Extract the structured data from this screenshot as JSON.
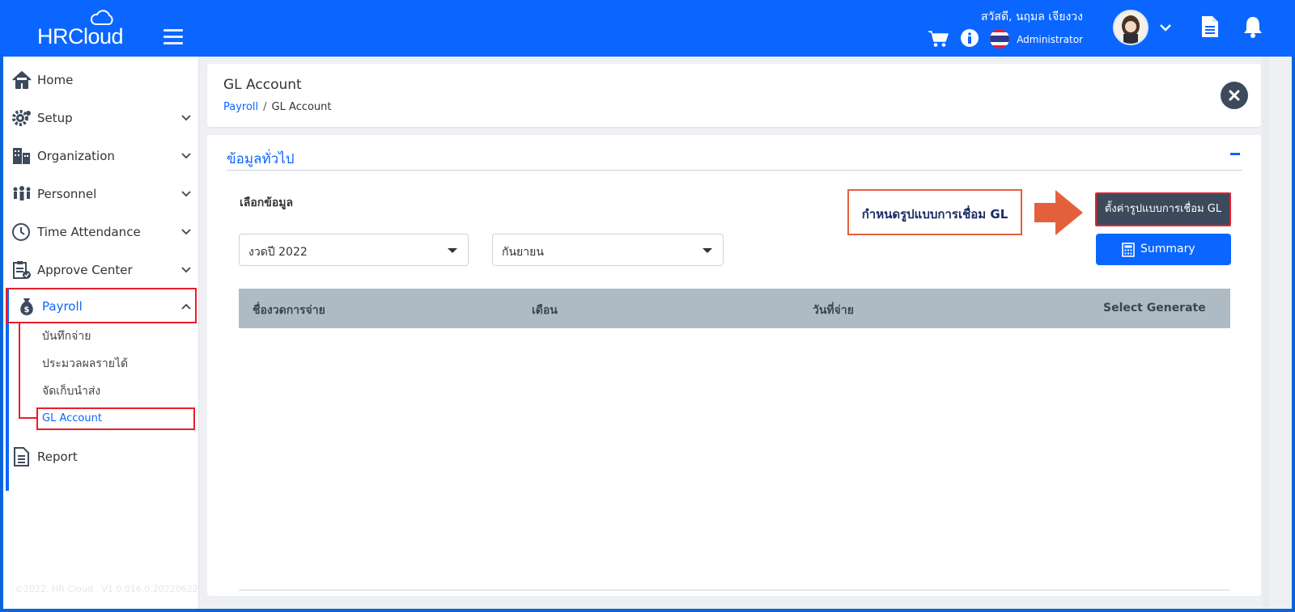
{
  "header": {
    "logo_text": "HRCloud",
    "greeting": "สวัสดี, นฤมล เจียงวง",
    "role": "Administrator",
    "icons": [
      "menu-icon",
      "cart-icon",
      "info-icon",
      "thai-flag-icon",
      "chevron-down-icon",
      "document-icon",
      "bell-icon"
    ]
  },
  "sidebar": {
    "items": [
      {
        "label": "Home",
        "icon": "home-icon"
      },
      {
        "label": "Setup",
        "icon": "gear-icon"
      },
      {
        "label": "Organization",
        "icon": "building-icon"
      },
      {
        "label": "Personnel",
        "icon": "people-icon"
      },
      {
        "label": "Time Attendance",
        "icon": "clock-icon"
      },
      {
        "label": "Approve Center",
        "icon": "clipboard-check-icon"
      },
      {
        "label": "Payroll",
        "icon": "money-bag-icon"
      },
      {
        "label": "Report",
        "icon": "report-icon"
      }
    ],
    "payroll_sub": [
      {
        "label": "บันทึกจ่าย"
      },
      {
        "label": "ประมวลผลรายได้"
      },
      {
        "label": "จัดเก็บนำส่ง"
      },
      {
        "label": "GL Account"
      }
    ],
    "copyright": "©2022. HR Cloud . V1.0.016.0.20220622"
  },
  "page": {
    "title": "GL Account",
    "breadcrumb": {
      "parent": "Payroll",
      "separator": "/",
      "current": "GL Account"
    }
  },
  "main": {
    "section_title": "ข้อมูลทั่วไป",
    "select_label": "เลือกข้อมูล",
    "period_select": "งวดปี 2022",
    "month_select": "กันยายน",
    "annotation": "กำหนดรูปแบบการเชื่อม GL",
    "gl_button": "ตั้งค่ารูปแบบการเชื่อม GL",
    "summary_button": "Summary",
    "table_headers": [
      "ชื่องวดการจ่าย",
      "เดือน",
      "วันที่จ่าย",
      "Select Generate"
    ]
  },
  "colors": {
    "brand_blue": "#0a66ff",
    "dark_button": "#3c4a5c",
    "highlight_red": "#e81e2c",
    "arrow_orange": "#e4603d",
    "table_header": "#aebbc4"
  }
}
